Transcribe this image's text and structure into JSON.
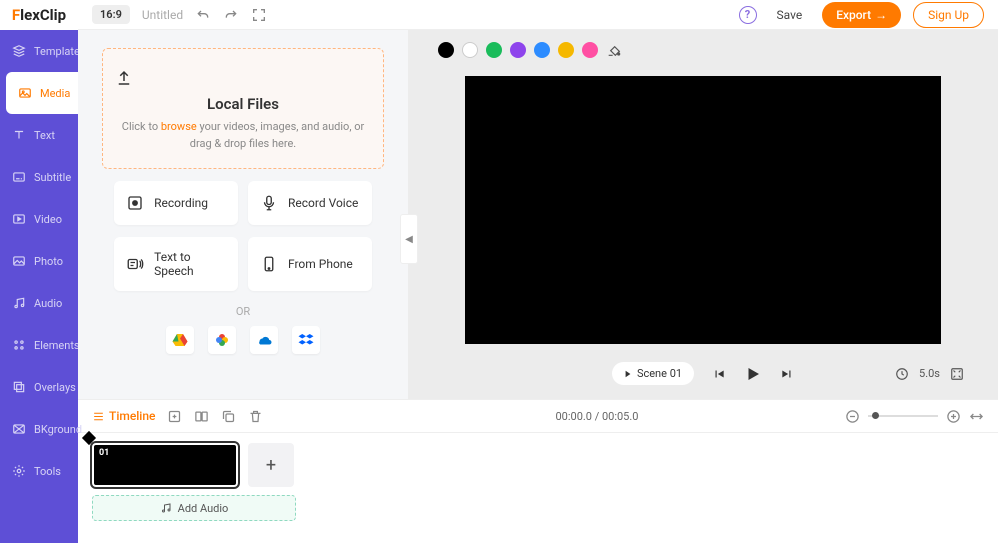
{
  "brand": {
    "pre": "F",
    "rest": "lexClip"
  },
  "sidebar": {
    "items": [
      {
        "label": "Templates",
        "icon": "stack"
      },
      {
        "label": "Media",
        "icon": "image",
        "active": true
      },
      {
        "label": "Text",
        "icon": "text"
      },
      {
        "label": "Subtitle",
        "icon": "subtitle"
      },
      {
        "label": "Video",
        "icon": "video"
      },
      {
        "label": "Photo",
        "icon": "photo"
      },
      {
        "label": "Audio",
        "icon": "audio"
      },
      {
        "label": "Elements",
        "icon": "elements"
      },
      {
        "label": "Overlays",
        "icon": "overlays"
      },
      {
        "label": "BKground",
        "icon": "bg"
      },
      {
        "label": "Tools",
        "icon": "tools"
      }
    ]
  },
  "topbar": {
    "ratio": "16:9",
    "title": "Untitled",
    "save": "Save",
    "export": "Export",
    "signup": "Sign Up"
  },
  "media_panel": {
    "drop_title": "Local Files",
    "drop_pre": "Click to ",
    "drop_browse": "browse",
    "drop_post": " your videos, images, and audio, or drag & drop files here.",
    "tiles": [
      {
        "label": "Recording",
        "icon": "record"
      },
      {
        "label": "Record Voice",
        "icon": "mic"
      },
      {
        "label": "Text to Speech",
        "icon": "tts"
      },
      {
        "label": "From Phone",
        "icon": "phone"
      }
    ],
    "or": "OR",
    "clouds": [
      "gdrive",
      "gphotos",
      "onedrive",
      "dropbox"
    ]
  },
  "colors": [
    "black",
    "white",
    "green",
    "purple",
    "blue",
    "yellow",
    "pink"
  ],
  "player": {
    "scene_label": "Scene 01",
    "duration": "5.0s"
  },
  "timeline": {
    "label": "Timeline",
    "time": "00:00.0 / 00:05.0",
    "clip_num": "01",
    "add_audio": "Add Audio"
  }
}
